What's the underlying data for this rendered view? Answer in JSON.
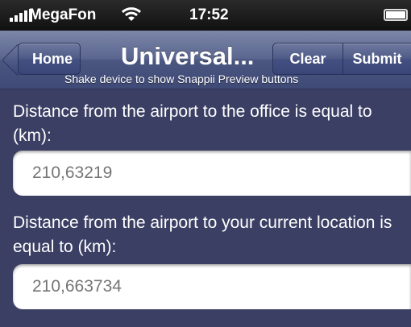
{
  "status_bar": {
    "carrier": "MegaFon",
    "time": "17:52",
    "icons": [
      "signal-bars-icon",
      "wifi-icon",
      "battery-icon"
    ]
  },
  "nav_bar": {
    "back_button": "Home",
    "title": "Universal...",
    "clear_button": "Clear",
    "submit_button": "Submit",
    "hint": "Shake device to show Snappii Preview buttons"
  },
  "form": {
    "fields": [
      {
        "label": "Distance from the airport to the office is equal to (km):",
        "placeholder": "210,63219"
      },
      {
        "label": "Distance from the airport to your current location is equal to (km):",
        "placeholder": "210,663734"
      }
    ]
  },
  "colors": {
    "background": "#3b3f64",
    "nav_bar": "#4a5680",
    "status_bar": "#111111",
    "input_text": "#b8b8b8"
  }
}
